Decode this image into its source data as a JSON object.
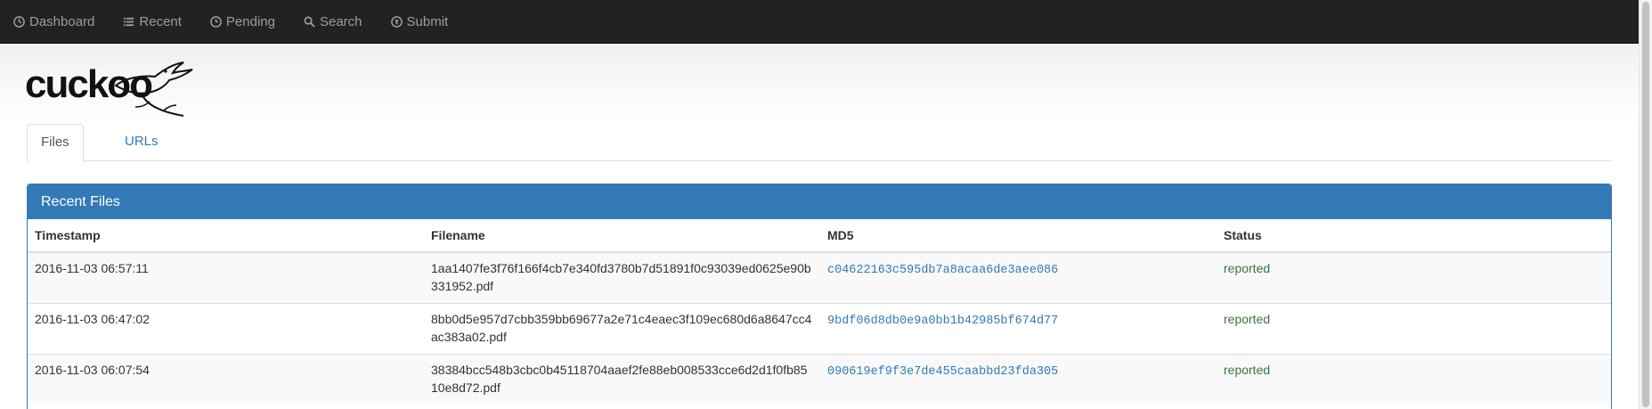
{
  "nav": {
    "items": [
      {
        "label": "Dashboard",
        "icon": "dashboard-icon"
      },
      {
        "label": "Recent",
        "icon": "list-icon"
      },
      {
        "label": "Pending",
        "icon": "clock-icon"
      },
      {
        "label": "Search",
        "icon": "search-icon"
      },
      {
        "label": "Submit",
        "icon": "upload-icon"
      }
    ]
  },
  "logo": {
    "text": "cuckoo"
  },
  "tabs": [
    {
      "label": "Files",
      "active": true
    },
    {
      "label": "URLs",
      "active": false
    }
  ],
  "panel": {
    "title": "Recent Files",
    "columns": [
      "Timestamp",
      "Filename",
      "MD5",
      "Status"
    ],
    "rows": [
      {
        "timestamp": "2016-11-03 06:57:11",
        "filename": "1aa1407fe3f76f166f4cb7e340fd3780b7d51891f0c93039ed0625e90b331952.pdf",
        "md5": "c04622163c595db7a8acaa6de3aee086",
        "status": "reported"
      },
      {
        "timestamp": "2016-11-03 06:47:02",
        "filename": "8bb0d5e957d7cbb359bb69677a2e71c4eaec3f109ec680d6a8647cc4ac383a02.pdf",
        "md5": "9bdf06d8db0e9a0bb1b42985bf674d77",
        "status": "reported"
      },
      {
        "timestamp": "2016-11-03 06:07:54",
        "filename": "38384bcc548b3cbc0b45118704aaef2fe88eb008533cce6d2d1f0fb8510e8d72.pdf",
        "md5": "090619ef9f3e7de455caabbd23fda305",
        "status": "reported"
      }
    ]
  },
  "colors": {
    "navbar": "#222222",
    "link": "#337ab7",
    "panel": "#337ab7",
    "status_ok": "#3c763d"
  }
}
